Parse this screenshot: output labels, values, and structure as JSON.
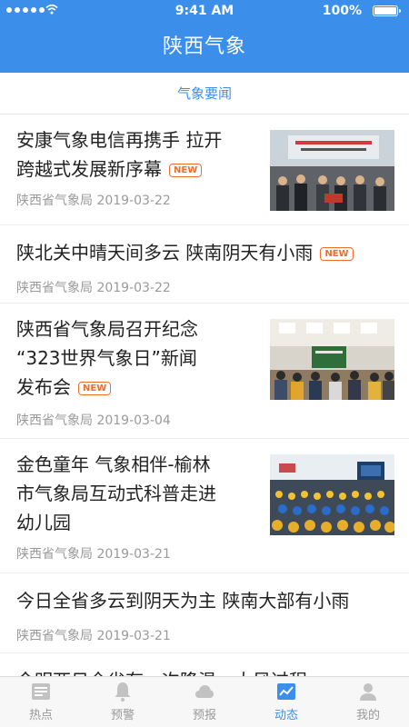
{
  "status_bar": {
    "time": "9:41 AM",
    "battery": "100%"
  },
  "header": {
    "title": "陕西气象"
  },
  "section": {
    "label": "气象要闻"
  },
  "articles": [
    {
      "title_lines": [
        "安康气象电信再携手 拉开",
        "跨越式发展新序幕"
      ],
      "badge": "NEW",
      "source": "陕西省气象局",
      "date": "2019-03-22"
    },
    {
      "title_lines": [
        "陕北关中晴天间多云 陕南阴天有小雨"
      ],
      "badge": "NEW",
      "source": "陕西省气象局",
      "date": "2019-03-22"
    },
    {
      "title_lines": [
        "陕西省气象局召开纪念",
        "“323世界气象日”新闻",
        "发布会"
      ],
      "badge": "NEW",
      "source": "陕西省气象局",
      "date": "2019-03-04"
    },
    {
      "title_lines": [
        "金色童年 气象相伴-榆林",
        "市气象局互动式科普走进",
        "幼儿园"
      ],
      "badge": "",
      "source": "陕西省气象局",
      "date": "2019-03-21"
    },
    {
      "title_lines": [
        "今日全省多云到阴天为主 陕南大部有小雨"
      ],
      "badge": "",
      "source": "陕西省气象局",
      "date": "2019-03-21"
    },
    {
      "title_lines": [
        "今明两日全省有一次降温、大风过程"
      ],
      "badge": "",
      "source": "",
      "date": ""
    }
  ],
  "tabbar": {
    "items": [
      {
        "label": "热点",
        "icon": "news-icon",
        "active": false
      },
      {
        "label": "预警",
        "icon": "bell-icon",
        "active": false
      },
      {
        "label": "预报",
        "icon": "cloud-icon",
        "active": false
      },
      {
        "label": "动态",
        "icon": "chart-icon",
        "active": true
      },
      {
        "label": "我的",
        "icon": "user-icon",
        "active": false
      }
    ]
  },
  "colors": {
    "brand": "#3b8ee9",
    "badge": "#f06c2d",
    "text": "#222222",
    "meta": "#9a9a9a"
  }
}
